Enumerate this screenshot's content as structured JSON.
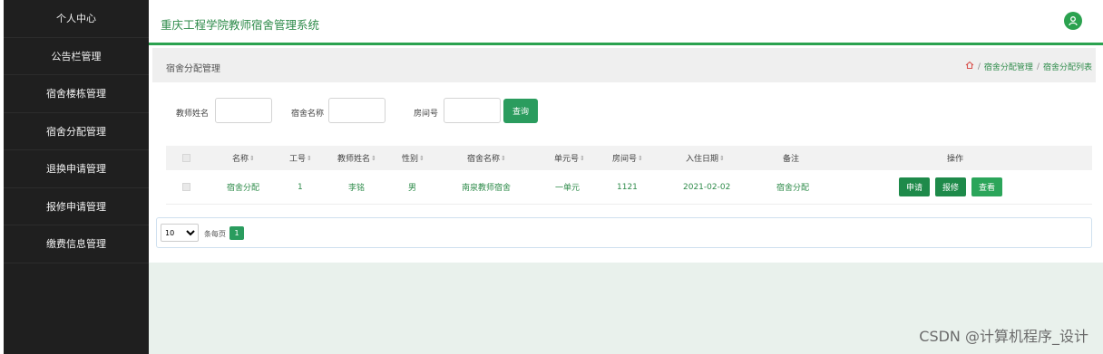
{
  "sidebar": {
    "items": [
      {
        "label": "个人中心"
      },
      {
        "label": "公告栏管理"
      },
      {
        "label": "宿舍楼栋管理"
      },
      {
        "label": "宿舍分配管理"
      },
      {
        "label": "退换申请管理"
      },
      {
        "label": "报修申请管理"
      },
      {
        "label": "缴费信息管理"
      }
    ]
  },
  "header": {
    "title": "重庆工程学院教师宿舍管理系统",
    "user_icon": "user-icon"
  },
  "breadcrumb": {
    "page_title": "宿舍分配管理",
    "home_icon": "home-icon",
    "items": [
      "宿舍分配管理",
      "宿舍分配列表"
    ],
    "separator": "/"
  },
  "search": {
    "teacher_name_label": "教师姓名",
    "teacher_name_value": "",
    "dorm_name_label": "宿舍名称",
    "dorm_name_value": "",
    "room_label": "房间号",
    "room_value": "",
    "query_button": "查询"
  },
  "table": {
    "sort_icon": "sort-icon",
    "headers": {
      "name": "名称",
      "job_no": "工号",
      "teacher_name": "教师姓名",
      "gender": "性别",
      "dorm_name": "宿舍名称",
      "unit_no": "单元号",
      "room_no": "房间号",
      "checkin_date": "入住日期",
      "remark": "备注",
      "actions": "操作"
    },
    "rows": [
      {
        "name": "宿舍分配",
        "job_no": "1",
        "teacher_name": "李铭",
        "gender": "男",
        "dorm_name": "南泉教师宿舍",
        "unit_no": "一单元",
        "room_no": "1121",
        "checkin_date": "2021-02-02",
        "remark": "宿舍分配",
        "actions": [
          "申请",
          "报修",
          "查看"
        ]
      }
    ]
  },
  "pagination": {
    "page_size": "10",
    "page_size_options": [
      "10"
    ],
    "per_page_label": "条每页",
    "current_page": "1"
  },
  "watermark": "CSDN @计算机程序_设计",
  "colors": {
    "accent": "#2ba24f",
    "sidebar_bg": "#1f1f1f",
    "button": "#2a9c5e"
  }
}
